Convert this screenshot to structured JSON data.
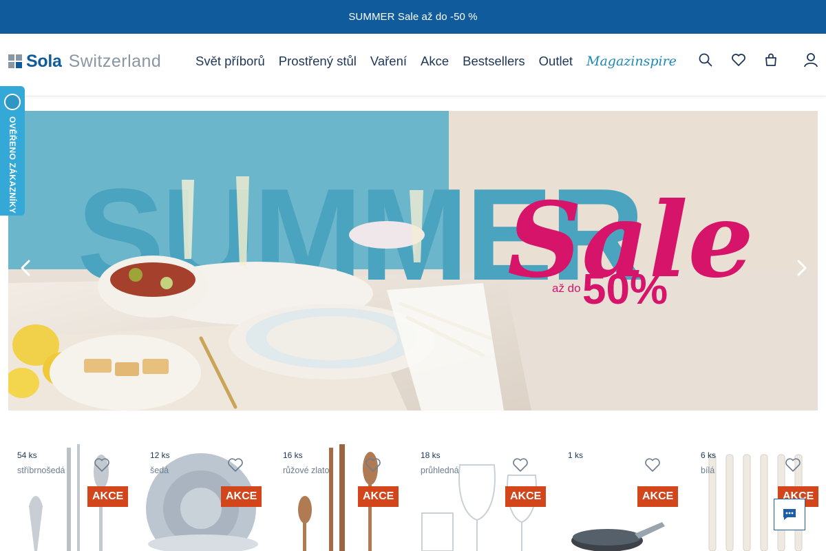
{
  "promo": {
    "text": "SUMMER Sale až do -50 %"
  },
  "logo": {
    "brand": "Sola",
    "brand2": "Switzerland",
    "dot_colors": [
      "#8a96a3",
      "#8a96a3",
      "#8a96a3",
      "#0f5b9b"
    ]
  },
  "nav": {
    "items": [
      "Svět příborů",
      "Prostřený stůl",
      "Vaření",
      "Akce",
      "Bestsellers",
      "Outlet"
    ],
    "magazine": "Magazinspire"
  },
  "header_icons": [
    "search-icon",
    "heart-icon",
    "shopping-bag-icon",
    "user-icon"
  ],
  "verify_badge": {
    "text": "OVĚŘENO ZÁKAZNÍKY"
  },
  "hero": {
    "title_word": "SUMMER",
    "sale_script": "Sale",
    "prefix": "až do",
    "percent": "50%",
    "colors": {
      "sky": "#6cb6cb",
      "sale": "#d6156a",
      "text": "#4aa3bf"
    }
  },
  "products": [
    {
      "qty": "54 ks",
      "color": "stříbrnošedá",
      "badge": "AKCE",
      "kind": "cutlery-silver"
    },
    {
      "qty": "12 ks",
      "color": "šedá",
      "badge": "AKCE",
      "kind": "plates-grey"
    },
    {
      "qty": "16 ks",
      "color": "růžové zlato",
      "badge": "AKCE",
      "kind": "cutlery-rose"
    },
    {
      "qty": "18 ks",
      "color": "průhledná",
      "badge": "AKCE",
      "kind": "glasses"
    },
    {
      "qty": "1 ks",
      "color": "",
      "badge": "AKCE",
      "kind": "pan"
    },
    {
      "qty": "6 ks",
      "color": "bílá",
      "badge": "AKCE",
      "kind": "knives-white"
    }
  ],
  "colors": {
    "primary": "#0f5b9b",
    "accent": "#34a9d8",
    "badge": "#d3451b"
  }
}
